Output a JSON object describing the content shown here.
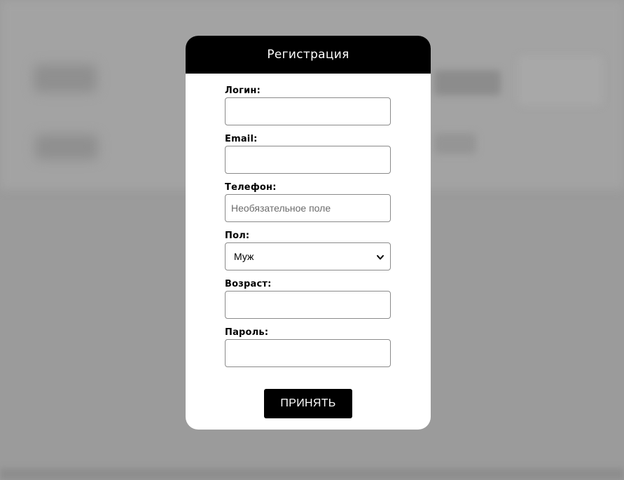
{
  "modal": {
    "title": "Регистрация",
    "fields": {
      "login": {
        "label": "Логин:",
        "value": "",
        "placeholder": ""
      },
      "email": {
        "label": "Email:",
        "value": "",
        "placeholder": ""
      },
      "phone": {
        "label": "Телефон:",
        "value": "",
        "placeholder": "Необязательное поле"
      },
      "gender": {
        "label": "Пол:",
        "selected": "Муж"
      },
      "age": {
        "label": "Возраст:",
        "value": "",
        "placeholder": ""
      },
      "password": {
        "label": "Пароль:",
        "value": "",
        "placeholder": ""
      }
    },
    "submit_label": "ПРИНЯТЬ"
  },
  "icons": {
    "gender_dropdown": "chevron-down-icon"
  },
  "colors": {
    "overlay": "#9c9c9c",
    "header_bg": "#000000",
    "header_text": "#ffffff",
    "button_bg": "#000000",
    "button_text": "#ffffff",
    "input_border": "#8a8a8a"
  }
}
